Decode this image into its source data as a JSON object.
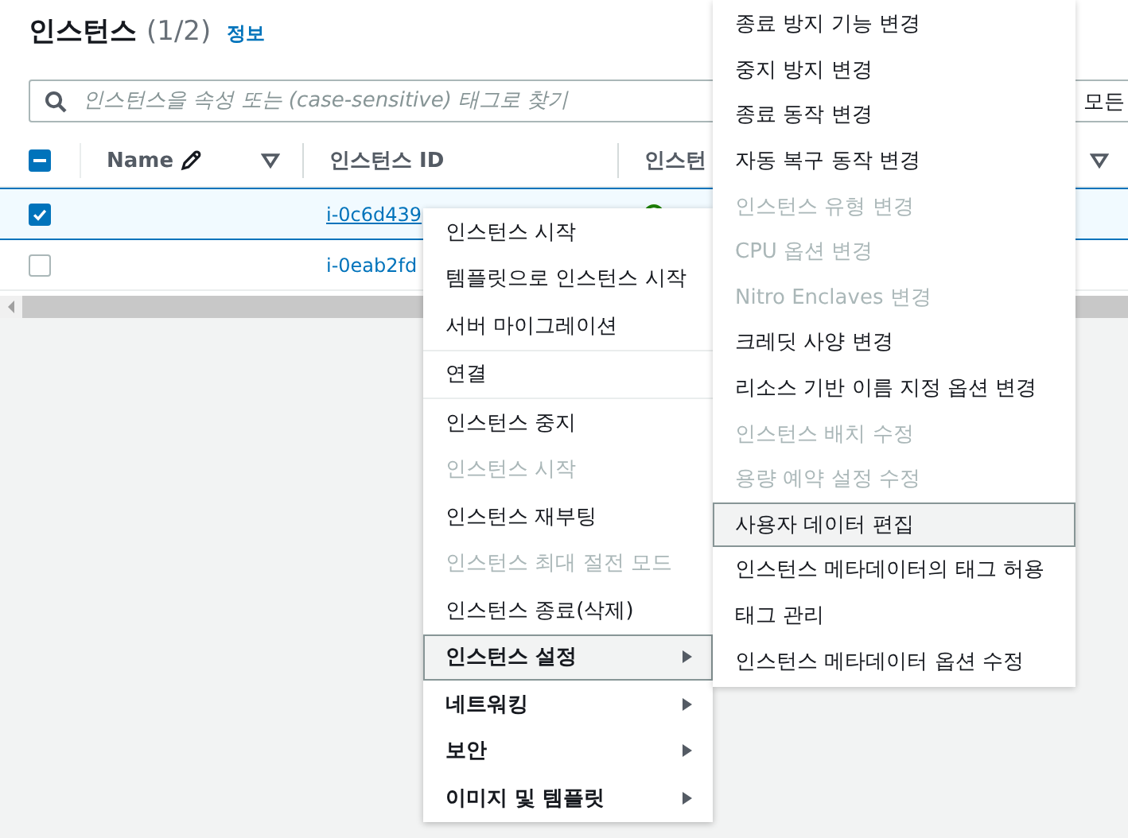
{
  "header": {
    "title": "인스턴스",
    "count": "(1/2)",
    "info_link": "정보"
  },
  "search": {
    "placeholder": "인스턴스을 속성 또는 (case-sensitive) 태그로 찾기",
    "filter_label": "모든"
  },
  "table": {
    "select_all": {
      "indeterminate": true
    },
    "columns": [
      {
        "label": "Name",
        "editable": true,
        "filter": true
      },
      {
        "label": "인스턴스 ID",
        "editable": false,
        "filter": false
      },
      {
        "label": "인스턴"
      }
    ],
    "rows": [
      {
        "selected": true,
        "instance_id": "i-0c6d439",
        "color": "#1d8102"
      },
      {
        "selected": false,
        "instance_id": "i-0eab2fd"
      }
    ]
  },
  "context_menu": {
    "groups": [
      [
        {
          "label": "인스턴스 시작",
          "disabled": false,
          "submenu": false,
          "selected": false
        },
        {
          "label": "템플릿으로 인스턴스 시작",
          "disabled": false,
          "submenu": false,
          "selected": false
        },
        {
          "label": "서버 마이그레이션",
          "disabled": false,
          "submenu": false,
          "selected": false
        }
      ],
      [
        {
          "label": "연결",
          "disabled": false,
          "submenu": false,
          "selected": false
        }
      ],
      [
        {
          "label": "인스턴스 중지",
          "disabled": false,
          "submenu": false,
          "selected": false
        },
        {
          "label": "인스턴스 시작",
          "disabled": true,
          "submenu": false,
          "selected": false
        },
        {
          "label": "인스턴스 재부팅",
          "disabled": false,
          "submenu": false,
          "selected": false
        },
        {
          "label": "인스턴스 최대 절전 모드",
          "disabled": true,
          "submenu": false,
          "selected": false
        },
        {
          "label": "인스턴스 종료(삭제)",
          "disabled": false,
          "submenu": false,
          "selected": false
        },
        {
          "label": "인스턴스 설정",
          "disabled": false,
          "submenu": true,
          "selected": true
        },
        {
          "label": "네트워킹",
          "disabled": false,
          "submenu": true,
          "selected": false
        },
        {
          "label": "보안",
          "disabled": false,
          "submenu": true,
          "selected": false
        },
        {
          "label": "이미지 및 템플릿",
          "disabled": false,
          "submenu": true,
          "selected": false
        }
      ]
    ]
  },
  "submenu": {
    "items": [
      {
        "label": "종료 방지 기능 변경",
        "disabled": false,
        "selected": false
      },
      {
        "label": "중지 방지 변경",
        "disabled": false,
        "selected": false
      },
      {
        "label": "종료 동작 변경",
        "disabled": false,
        "selected": false
      },
      {
        "label": "자동 복구 동작 변경",
        "disabled": false,
        "selected": false
      },
      {
        "label": "인스턴스 유형 변경",
        "disabled": true,
        "selected": false
      },
      {
        "label": "CPU 옵션 변경",
        "disabled": true,
        "selected": false
      },
      {
        "label": "Nitro Enclaves 변경",
        "disabled": true,
        "selected": false
      },
      {
        "label": "크레딧 사양 변경",
        "disabled": false,
        "selected": false
      },
      {
        "label": "리소스 기반 이름 지정 옵션 변경",
        "disabled": false,
        "selected": false
      },
      {
        "label": "인스턴스 배치 수정",
        "disabled": true,
        "selected": false
      },
      {
        "label": "용량 예약 설정 수정",
        "disabled": true,
        "selected": false
      },
      {
        "label": "사용자 데이터 편집",
        "disabled": false,
        "selected": true
      },
      {
        "label": "인스턴스 메타데이터의 태그 허용",
        "disabled": false,
        "selected": false
      },
      {
        "label": "태그 관리",
        "disabled": false,
        "selected": false
      },
      {
        "label": "인스턴스 메타데이터 옵션 수정",
        "disabled": false,
        "selected": false
      }
    ]
  }
}
